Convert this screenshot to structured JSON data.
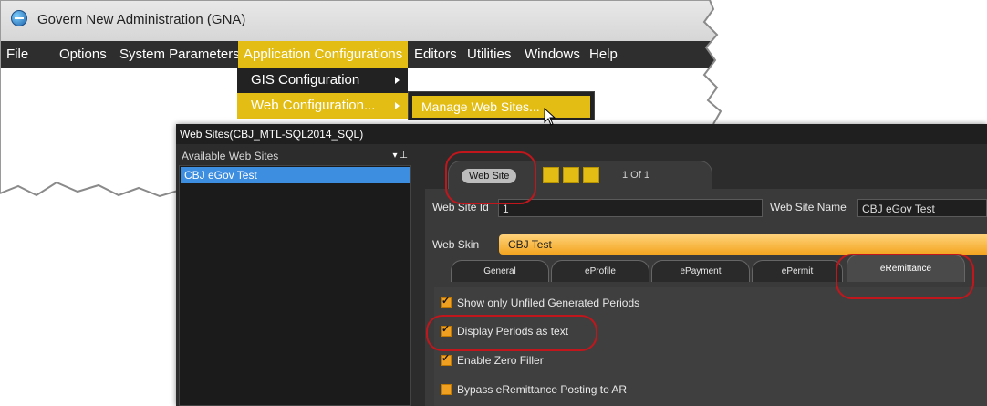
{
  "gna": {
    "title": "Govern New Administration (GNA)",
    "menu": [
      "File",
      "Options",
      "System Parameters",
      "Application Configurations",
      "Editors",
      "Utilities",
      "Windows",
      "Help"
    ],
    "dropdown": [
      "GIS Configuration",
      "Web Configuration..."
    ],
    "submenu": "Manage Web Sites..."
  },
  "web_sites": {
    "title": "Web Sites(CBJ_MTL-SQL2014_SQL)",
    "list_header": "Available Web Sites",
    "list_header_icons": "▾ ⊥",
    "sites": [
      "CBJ eGov Test"
    ],
    "tab_label": "Web Site",
    "pager": "1 Of 1",
    "fields": {
      "id_label": "Web Site Id",
      "id_value": "1",
      "name_label": "Web Site Name",
      "name_value": "CBJ eGov Test",
      "skin_label": "Web Skin",
      "skin_value": "CBJ Test"
    },
    "subtabs": [
      "General",
      "eProfile",
      "ePayment",
      "ePermit",
      "eRemittance"
    ],
    "options": [
      {
        "label": "Show only Unfiled Generated Periods",
        "checked": true
      },
      {
        "label": "Display Periods as text",
        "checked": true
      },
      {
        "label": "Enable Zero Filler",
        "checked": true
      },
      {
        "label": "Bypass eRemittance Posting to AR",
        "checked": false
      }
    ]
  },
  "colors": {
    "accent": "#e3bd14",
    "selection": "#3d8de0",
    "highlight_ring": "#c0161c",
    "skin_field": "#f3a51f"
  }
}
